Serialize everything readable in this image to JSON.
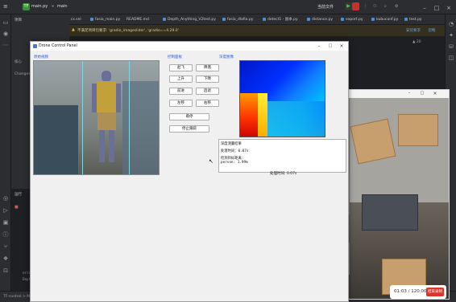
{
  "ide": {
    "project_badge": "TF",
    "project_name": "main.py",
    "branch": "main",
    "run_config": "当前文件",
    "tabs": [
      "cs.sel",
      "fasia_main.py",
      "README.md",
      "Depth_Anything_V2test.py",
      "fasia_dlafia.py",
      "detect1 - 副本.py",
      "distance.py",
      "export.py",
      "kubuconf.py",
      "test.py"
    ],
    "project_panel_label": "项目",
    "panel_items": [
      "核心",
      "Changes"
    ],
    "run_panel_label": "运行",
    "warning_text": "不满足项目包要求: 'gradio_imageslider', 'gradio==4.29.0'",
    "warning_link_install": "安装要求",
    "warning_link_ignore": "忽略",
    "line_indicator": "▲ 20",
    "console_lines": [
      "orientation: (244, 320) >=0.0 ...",
      "Depth stats: min=0.4927, max=9.7631"
    ],
    "status_bar": "TF-control > Molecular_company-team > fasia_main.py"
  },
  "drone_panel": {
    "title": "Drone Control Panel",
    "video_group_title": "原始视频",
    "controls_group_title": "控制面板",
    "depth_group_title": "深度图像",
    "buttons": {
      "takeoff": "起飞",
      "land": "降落",
      "up": "上升",
      "down": "下降",
      "forward": "前进",
      "back": "后退",
      "left": "左移",
      "right": "右移",
      "hover": "悬停",
      "stop_tracking": "停止跟踪"
    },
    "info": {
      "header": "深度测量结果",
      "proc_time": "处理时间：0.07s",
      "detect_label": "检测目标距离:",
      "detect_value": "person: 1.99m"
    },
    "process_time": "处理时间: 0.07s"
  },
  "recorder": {
    "timer": "01:03 / 120:00",
    "end_label": "结束录制"
  }
}
